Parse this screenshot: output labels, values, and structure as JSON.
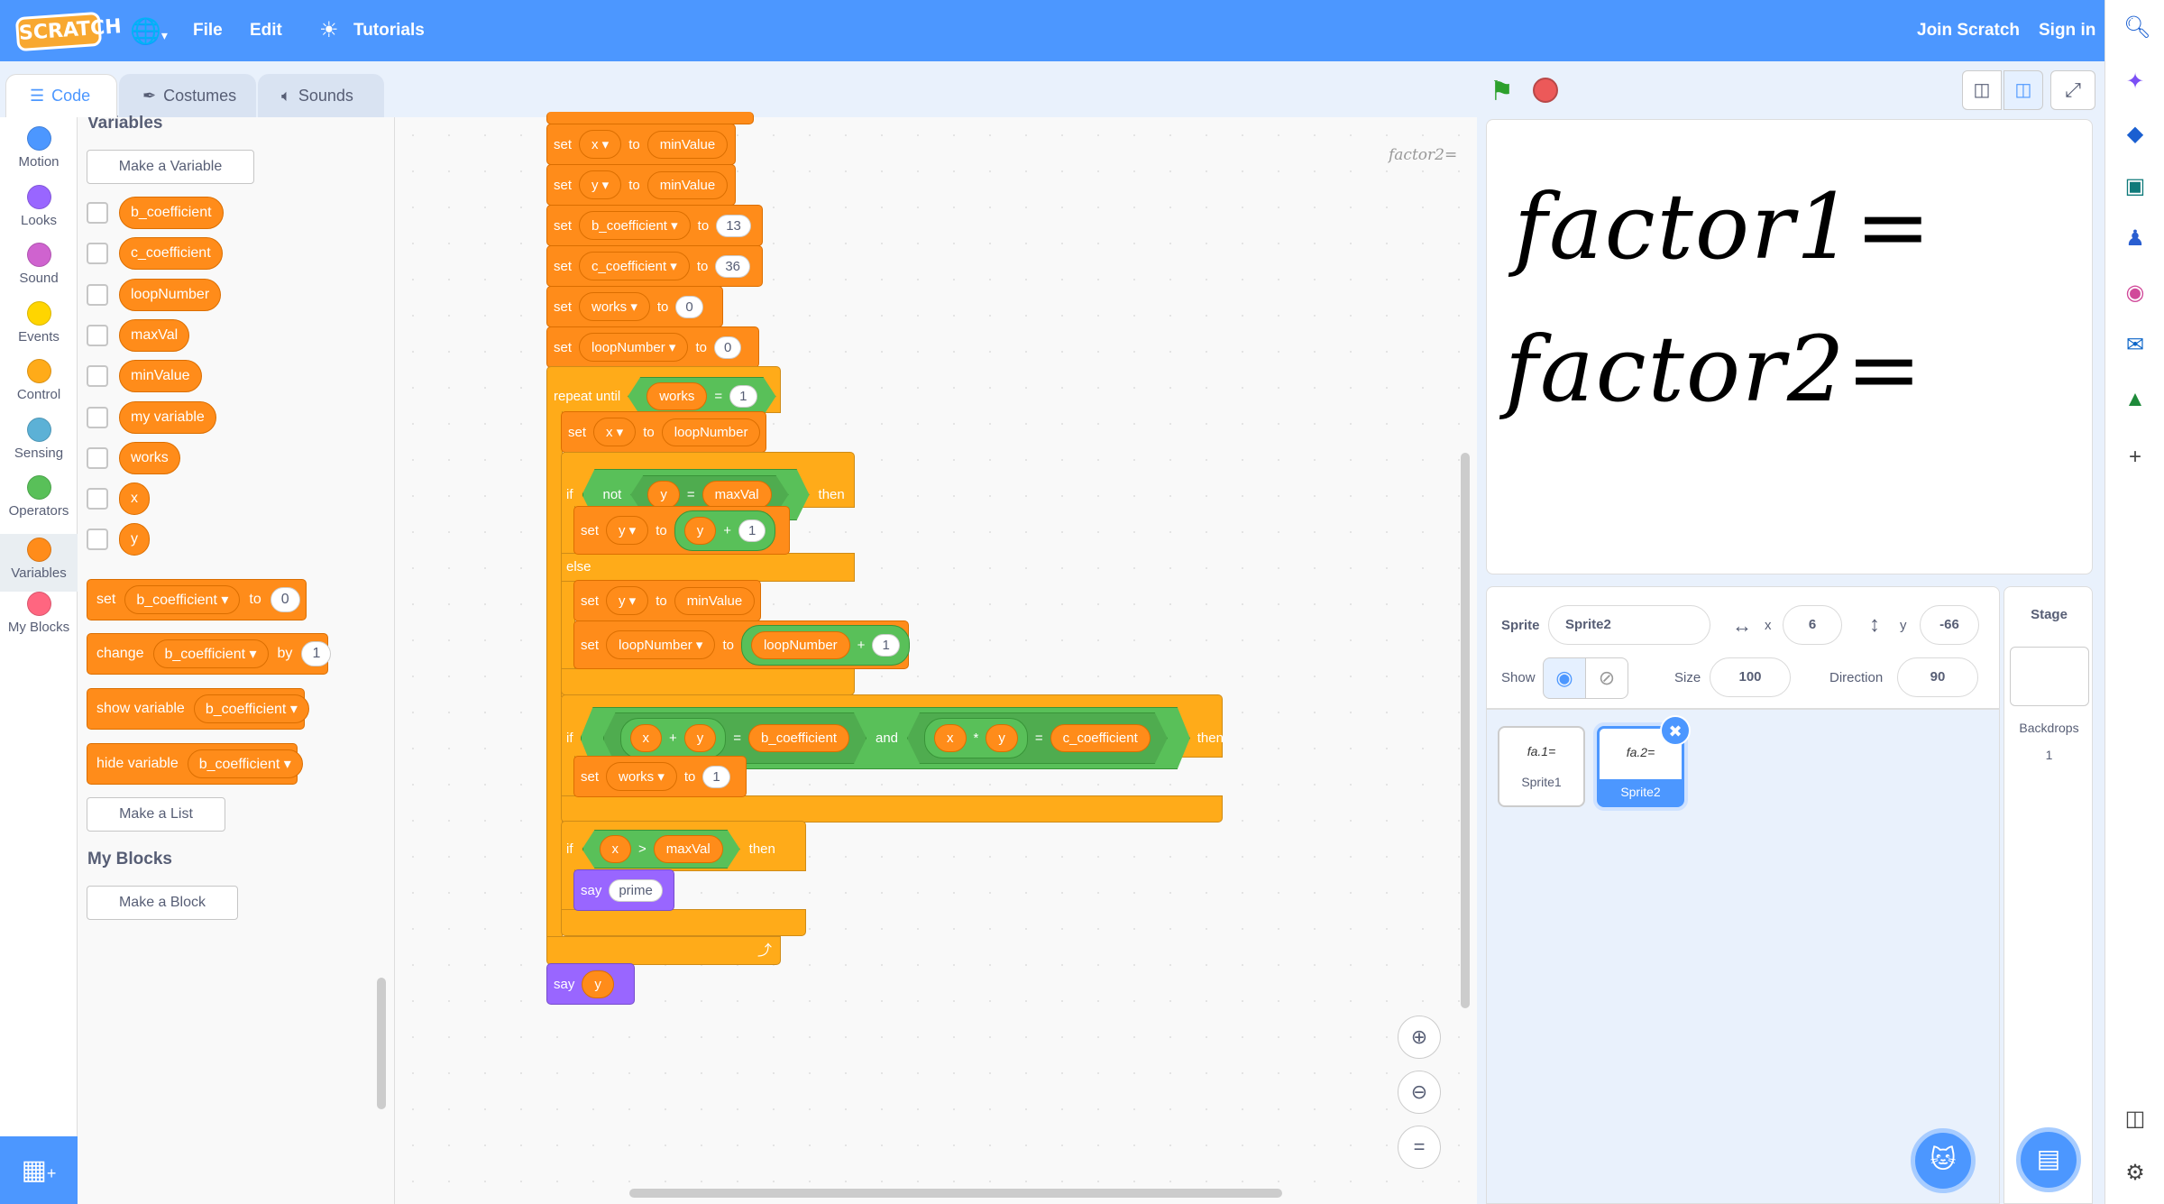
{
  "menubar": {
    "logo": "SCRATCH",
    "file": "File",
    "edit": "Edit",
    "tutorials": "Tutorials",
    "join": "Join Scratch",
    "signin": "Sign in"
  },
  "tabs": {
    "code": "Code",
    "costumes": "Costumes",
    "sounds": "Sounds"
  },
  "categories": [
    {
      "label": "Motion",
      "color": "#4c97ff"
    },
    {
      "label": "Looks",
      "color": "#9966ff"
    },
    {
      "label": "Sound",
      "color": "#cf63cf"
    },
    {
      "label": "Events",
      "color": "#ffd500"
    },
    {
      "label": "Control",
      "color": "#ffab19"
    },
    {
      "label": "Sensing",
      "color": "#5cb1d6"
    },
    {
      "label": "Operators",
      "color": "#59c059"
    },
    {
      "label": "Variables",
      "color": "#ff8c1a"
    },
    {
      "label": "My Blocks",
      "color": "#ff6680"
    }
  ],
  "palette": {
    "heading": "Variables",
    "make_variable": "Make a Variable",
    "variables": [
      "b_coefficient",
      "c_coefficient",
      "loopNumber",
      "maxVal",
      "minValue",
      "my variable",
      "works",
      "x",
      "y"
    ],
    "set_block": {
      "label": "set",
      "var": "b_coefficient",
      "to": "to",
      "value": "0"
    },
    "change_block": {
      "label": "change",
      "var": "b_coefficient",
      "by": "by",
      "value": "1"
    },
    "show_block": {
      "label": "show variable",
      "var": "b_coefficient"
    },
    "hide_block": {
      "label": "hide variable",
      "var": "b_coefficient"
    },
    "make_list": "Make a List",
    "myblocks_heading": "My Blocks",
    "make_block": "Make a Block"
  },
  "script": {
    "set": "set",
    "to": "to",
    "b1": {
      "var": "x",
      "val": "minValue"
    },
    "b2": {
      "var": "y",
      "val": "minValue"
    },
    "b3": {
      "var": "b_coefficient",
      "val": "13"
    },
    "b4": {
      "var": "c_coefficient",
      "val": "36"
    },
    "b5": {
      "var": "works",
      "val": "0"
    },
    "b6": {
      "var": "loopNumber",
      "val": "0"
    },
    "repeat_until": "repeat until",
    "works": "works",
    "eq": "=",
    "one": "1",
    "x": "x",
    "y": "y",
    "loopNumber": "loopNumber",
    "if": "if",
    "not": "not",
    "maxVal": "maxVal",
    "then": "then",
    "plus": "+",
    "else": "else",
    "minValue": "minValue",
    "b_coefficient": "b_coefficient",
    "c_coefficient": "c_coefficient",
    "and": "and",
    "times": "*",
    "gt": ">",
    "say": "say",
    "prime": "prime",
    "arrow": "⤴",
    "note": "factor2="
  },
  "stage": {
    "line1": "factor1=",
    "line2": "factor2="
  },
  "sprite_info": {
    "sprite_label": "Sprite",
    "sprite_name": "Sprite2",
    "x_label": "x",
    "x_value": "6",
    "y_label": "y",
    "y_value": "-66",
    "show_label": "Show",
    "size_label": "Size",
    "size_value": "100",
    "direction_label": "Direction",
    "direction_value": "90"
  },
  "sprites": [
    {
      "name": "Sprite1",
      "thumb": "fa.1="
    },
    {
      "name": "Sprite2",
      "thumb": "fa.2="
    }
  ],
  "stage_panel": {
    "title": "Stage",
    "backdrops_label": "Backdrops",
    "backdrops_count": "1"
  }
}
